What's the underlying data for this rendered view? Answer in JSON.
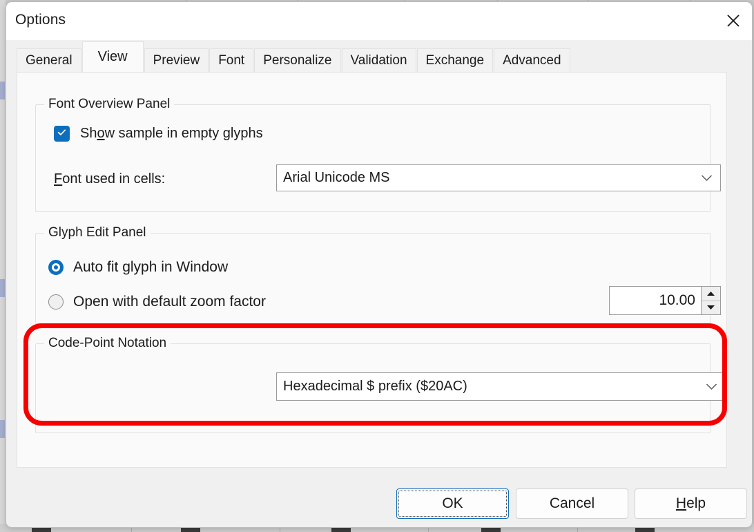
{
  "window": {
    "title": "Options",
    "close_icon": "close-icon"
  },
  "tabs": [
    {
      "label": "General",
      "active": false
    },
    {
      "label": "View",
      "active": true
    },
    {
      "label": "Preview",
      "active": false
    },
    {
      "label": "Font",
      "active": false
    },
    {
      "label": "Personalize",
      "active": false
    },
    {
      "label": "Validation",
      "active": false
    },
    {
      "label": "Exchange",
      "active": false
    },
    {
      "label": "Advanced",
      "active": false
    }
  ],
  "groups": {
    "font_overview": {
      "legend": "Font Overview Panel",
      "checkbox": {
        "label_pre": "Sh",
        "label_accel": "o",
        "label_post": "w sample in empty glyphs",
        "checked": true
      },
      "font_label_accel": "F",
      "font_label_rest": "ont used in cells:",
      "font_combo_value": "Arial Unicode MS"
    },
    "glyph_edit": {
      "legend": "Glyph Edit Panel",
      "radio_autofit": "Auto fit glyph in Window",
      "radio_zoom": "Open with default zoom factor",
      "selected": "radio_autofit",
      "zoom_value": "10.00"
    },
    "code_point": {
      "legend": "Code-Point Notation",
      "combo_value": "Hexadecimal $ prefix ($20AC)",
      "highlight_color": "#f80000"
    }
  },
  "footer": {
    "ok": "OK",
    "cancel": "Cancel",
    "help_accel": "H",
    "help_rest": "elp"
  },
  "colors": {
    "accent": "#0d6ebd",
    "dialog_bg": "#f0f0f0",
    "pane_bg": "#fafafa",
    "titlebar_bg": "#ffffff",
    "annotation": "#f80000"
  }
}
